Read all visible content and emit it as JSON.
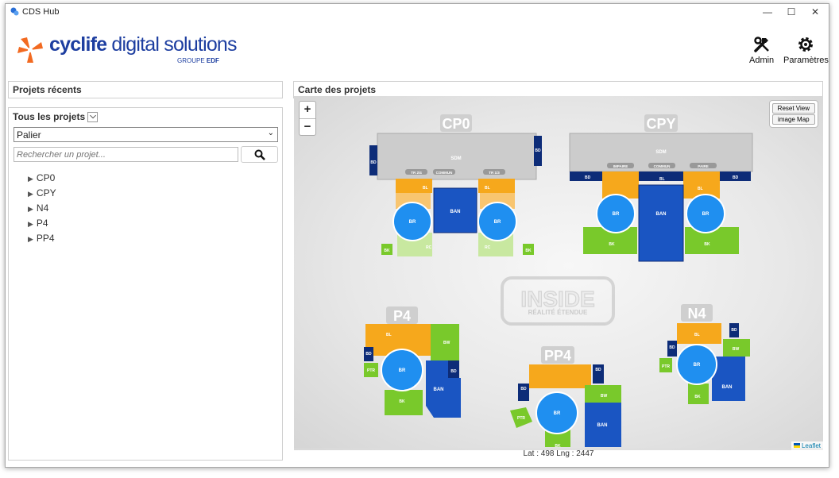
{
  "window": {
    "title": "CDS Hub",
    "controls": {
      "minimize": "—",
      "maximize": "☐",
      "close": "✕"
    }
  },
  "logo": {
    "brand": "cyclife",
    "tagline": "digital solutions",
    "group": "GROUPE",
    "group_brand": "EDF"
  },
  "header": {
    "admin_label": "Admin",
    "settings_label": "Paramètres"
  },
  "recent": {
    "title": "Projets récents"
  },
  "all": {
    "title": "Tous les projets",
    "dropdown_arrow": "⌵",
    "select_value": "Palier",
    "search_placeholder": "Rechercher un projet...",
    "projects": [
      "CP0",
      "CPY",
      "N4",
      "P4",
      "PP4"
    ]
  },
  "map": {
    "title": "Carte des projets",
    "zoom_in": "+",
    "zoom_out": "−",
    "reset_view": "Reset View",
    "image_map": "image Map",
    "leaflet": "Leaflet",
    "coords": "Lat : 498 Lng : 2447",
    "watermark_main": "INSIDE",
    "watermark_sub": "RÉALITÉ   ÉTENDUE",
    "sites": {
      "cp0": "CP0",
      "cpy": "CPY",
      "p4": "P4",
      "pp4": "PP4",
      "n4": "N4"
    },
    "labels": {
      "sdm": "SDM",
      "bd": "BD",
      "bl": "BL",
      "br": "BR",
      "ban": "BAN",
      "bk": "BK",
      "bw": "BW",
      "ptr": "PTR",
      "rc": "RC",
      "tr24": "TR 2/4",
      "tr13": "TR 1/3",
      "commun": "COMMUN",
      "impaire": "IMPAIRE",
      "paire": "PAIRE"
    }
  },
  "colors": {
    "orange": "#f6a81c",
    "navy": "#0d2c78",
    "blue": "#1a55c2",
    "circle": "#1f8ff0",
    "green": "#79c92b",
    "grey": "#cfcfcf"
  }
}
